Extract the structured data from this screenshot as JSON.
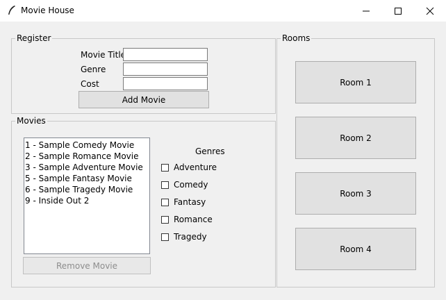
{
  "window": {
    "title": "Movie House"
  },
  "register": {
    "legend": "Register",
    "title_label": "Movie Title",
    "genre_label": "Genre",
    "cost_label": "Cost",
    "title_value": "",
    "genre_value": "",
    "cost_value": "",
    "add_button": "Add Movie"
  },
  "movies": {
    "legend": "Movies",
    "items": [
      "1 - Sample Comedy Movie",
      "2 - Sample Romance Movie",
      "3 - Sample Adventure Movie",
      "5 - Sample Fantasy Movie",
      "6 - Sample Tragedy Movie",
      "9 - Inside Out 2"
    ],
    "remove_button": "Remove Movie",
    "genres_heading": "Genres",
    "genres": [
      {
        "label": "Adventure",
        "checked": false
      },
      {
        "label": "Comedy",
        "checked": false
      },
      {
        "label": "Fantasy",
        "checked": false
      },
      {
        "label": "Romance",
        "checked": false
      },
      {
        "label": "Tragedy",
        "checked": false
      }
    ]
  },
  "rooms": {
    "legend": "Rooms",
    "buttons": [
      "Room 1",
      "Room 2",
      "Room 3",
      "Room 4"
    ]
  }
}
